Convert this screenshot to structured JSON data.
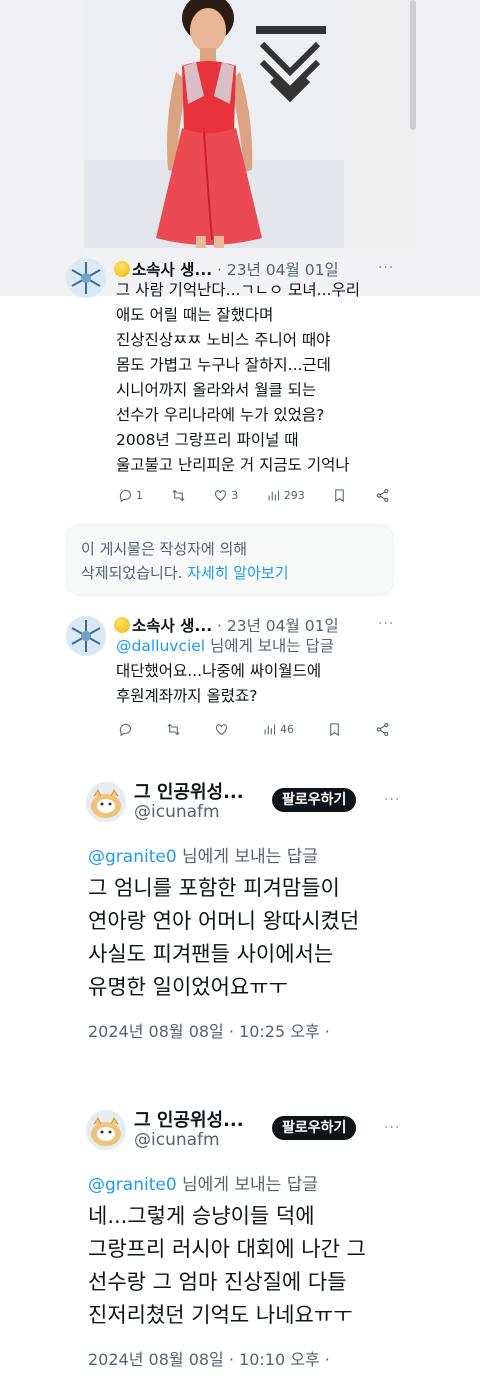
{
  "tweet1": {
    "name": "소속사 생...",
    "meta": " · 23년 04월 01일",
    "more": "···",
    "lines": [
      "그 사람 기억난다...ㄱㄴㅇ 모녀...우리",
      "애도 어릴 때는 잘했다며",
      "진상진상ㅉㅉ 노비스 주니어 때야",
      "몸도 가볍고 누구나 잘하지...근데",
      "시니어까지 올라와서 월클 되는",
      "선수가 우리나라에 누가 있었음?",
      "2008년 그랑프리 파이널 때",
      "울고불고 난리피운 거 지금도 기억나"
    ],
    "replies": "1",
    "likes": "3",
    "views": "293"
  },
  "deleted_notice": {
    "text": "이 게시물은 작성자에 의해",
    "text2": "삭제되었습니다. ",
    "link": "자세히 알아보기"
  },
  "tweet2": {
    "name": "소속사 생...",
    "meta": " · 23년 04월 01일",
    "more": "···",
    "reply_mention": "@dalluvciel",
    "reply_suffix": " 님에게 보내는 답글",
    "lines": [
      "대단했어요...나중에 싸이월드에",
      "후원계좌까지  올렸죠?"
    ],
    "views": "46"
  },
  "tweet3": {
    "name": "그 인공위성...",
    "handle": "@icunafm",
    "follow": "팔로우하기",
    "more": "···",
    "reply_mention": "@granite0",
    "reply_suffix": " 님에게 보내는 답글",
    "lines": [
      "그 엄니를 포함한 피겨맘들이",
      "연아랑 연아 어머니 왕따시켰던",
      "사실도 피겨팬들 사이에서는",
      "유명한 일이었어요ㅠㅜ"
    ],
    "timestamp": "2024년 08월 08일 · 10:25 오후 ·"
  },
  "tweet4": {
    "name": "그 인공위성...",
    "handle": "@icunafm",
    "follow": "팔로우하기",
    "more": "···",
    "reply_mention": "@granite0",
    "reply_suffix": " 님에게 보내는 답글",
    "lines": [
      "네...그렇게 승냥이들 덕에",
      "그랑프리 러시아 대회에 나간 그",
      "선수랑 그 엄마 진상질에 다들",
      "진저리쳤던 기억도 나네요ㅠㅜ"
    ],
    "timestamp": "2024년 08월 08일 · 10:10 오후 ·"
  },
  "colors": {
    "accent": "#1d9bf0",
    "text": "#0f1419",
    "muted": "#536471",
    "dress": "#e8333d"
  },
  "icons": [
    "reply-icon",
    "retweet-icon",
    "like-icon",
    "views-icon",
    "bookmark-icon",
    "share-icon"
  ]
}
